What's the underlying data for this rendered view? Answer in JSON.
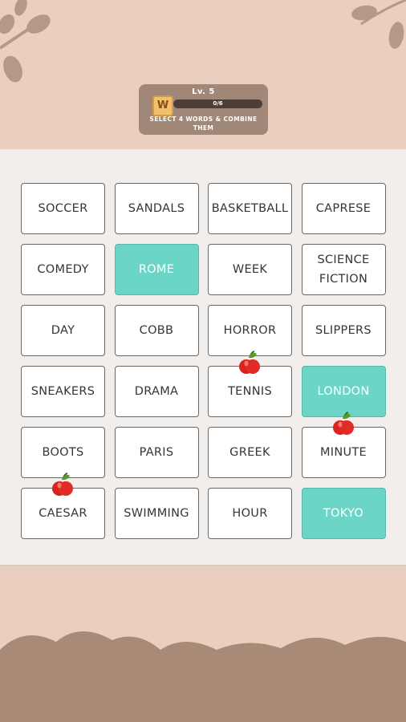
{
  "colors": {
    "background": "#ebcfbe",
    "board": "#f2eeeb",
    "selected_tile": "#6bd6c8",
    "hud": "#a08778",
    "foliage": "#a88a76"
  },
  "hud": {
    "badge_letter": "W",
    "level": "Lv. 5",
    "progress_text": "0/6",
    "progress_fraction": 0,
    "instruction": "SELECT 4 WORDS & COMBINE THEM"
  },
  "tiles": [
    {
      "label": "SOCCER",
      "selected": false
    },
    {
      "label": "SANDALS",
      "selected": false
    },
    {
      "label": "BASKETBALL",
      "selected": false
    },
    {
      "label": "CAPRESE",
      "selected": false
    },
    {
      "label": "COMEDY",
      "selected": false
    },
    {
      "label": "ROME",
      "selected": true
    },
    {
      "label": "WEEK",
      "selected": false
    },
    {
      "label": "SCIENCE\nFICTION",
      "selected": false
    },
    {
      "label": "DAY",
      "selected": false
    },
    {
      "label": "COBB",
      "selected": false
    },
    {
      "label": "HORROR",
      "selected": false
    },
    {
      "label": "SLIPPERS",
      "selected": false
    },
    {
      "label": "SNEAKERS",
      "selected": false
    },
    {
      "label": "DRAMA",
      "selected": false
    },
    {
      "label": "TENNIS",
      "selected": false,
      "apple": true
    },
    {
      "label": "LONDON",
      "selected": true
    },
    {
      "label": "BOOTS",
      "selected": false
    },
    {
      "label": "PARIS",
      "selected": false
    },
    {
      "label": "GREEK",
      "selected": false
    },
    {
      "label": "MINUTE",
      "selected": false,
      "apple": true
    },
    {
      "label": "CAESAR",
      "selected": false,
      "apple": true
    },
    {
      "label": "SWIMMING",
      "selected": false
    },
    {
      "label": "HOUR",
      "selected": false
    },
    {
      "label": "TOKYO",
      "selected": true
    }
  ],
  "icons": {
    "badge": "letter-tile-icon",
    "apple": "apple-icon",
    "leaves": "leaf-branch-icon"
  }
}
